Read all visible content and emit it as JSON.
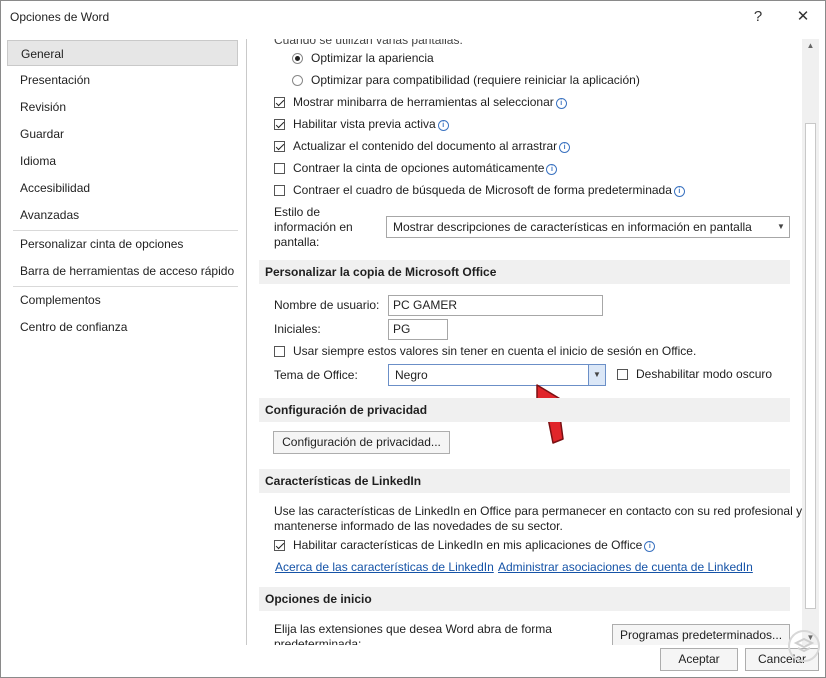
{
  "window": {
    "title": "Opciones de Word",
    "help": "?",
    "close": "✕"
  },
  "sidebar": {
    "items": [
      {
        "label": "General"
      },
      {
        "label": "Presentación"
      },
      {
        "label": "Revisión"
      },
      {
        "label": "Guardar"
      },
      {
        "label": "Idioma"
      },
      {
        "label": "Accesibilidad"
      },
      {
        "label": "Avanzadas"
      },
      {
        "label": "Personalizar cinta de opciones"
      },
      {
        "label": "Barra de herramientas de acceso rápido"
      },
      {
        "label": "Complementos"
      },
      {
        "label": "Centro de confianza"
      }
    ],
    "selected": "General"
  },
  "ui_options": {
    "partial_heading": "Cuando se utilizan varias pantallas:",
    "radio_optimize_appearance": "Optimizar la apariencia",
    "radio_optimize_compat": "Optimizar para compatibilidad (requiere reiniciar la aplicación)",
    "cb_minibar": "Mostrar minibarra de herramientas al seleccionar",
    "cb_preview": "Habilitar vista previa activa",
    "cb_update_drag": "Actualizar el contenido del documento al arrastrar",
    "cb_collapse_ribbon": "Contraer la cinta de opciones automáticamente",
    "cb_collapse_search": "Contraer el cuadro de búsqueda de Microsoft de forma predeterminada",
    "tooltip_style_label_1": "Estilo de",
    "tooltip_style_label_2": "información en",
    "tooltip_style_label_3": "pantalla:",
    "tooltip_style_value": "Mostrar descripciones de características en información en pantalla"
  },
  "personalize": {
    "heading": "Personalizar la copia de Microsoft Office",
    "username_label": "Nombre de usuario:",
    "username_value": "PC GAMER",
    "initials_label": "Iniciales:",
    "initials_value": "PG",
    "cb_always_use": "Usar siempre estos valores sin tener en cuenta el inicio de sesión en Office.",
    "theme_label": "Tema de Office:",
    "theme_value": "Negro",
    "cb_disable_dark": "Deshabilitar modo oscuro"
  },
  "privacy": {
    "heading": "Configuración de privacidad",
    "button": "Configuración de privacidad..."
  },
  "linkedin": {
    "heading": "Características de LinkedIn",
    "desc_1": "Use las características de LinkedIn en Office para permanecer en contacto con su red profesional y",
    "desc_2": "mantenerse informado de las novedades de su sector.",
    "cb_enable": "Habilitar características de LinkedIn en mis aplicaciones de Office",
    "link_about": "Acerca de las características de LinkedIn",
    "link_manage": "Administrar asociaciones de cuenta de LinkedIn"
  },
  "startup": {
    "heading": "Opciones de inicio",
    "desc_1": "Elija las extensiones que desea Word abra de forma",
    "desc_2": "predeterminada:",
    "button": "Programas predeterminados..."
  },
  "footer": {
    "accept": "Aceptar",
    "cancel": "Cancelar"
  },
  "colors": {
    "accent_arrow": "#e0252a",
    "link": "#1553a7",
    "section_bg": "#f0f0f0"
  }
}
